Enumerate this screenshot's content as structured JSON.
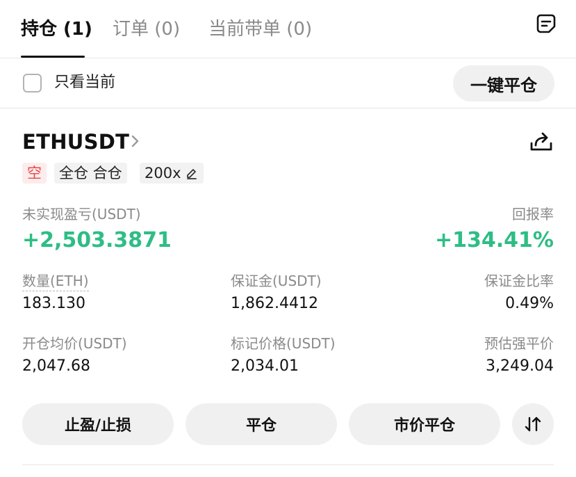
{
  "tabs": [
    {
      "label": "持仓 (1)"
    },
    {
      "label": "订单 (0)"
    },
    {
      "label": "当前带单 (0)"
    }
  ],
  "filter": {
    "only_current_label": "只看当前",
    "close_all_label": "一键平仓"
  },
  "position": {
    "symbol": "ETHUSDT",
    "tags": {
      "side": "空",
      "margin_mode": "全仓 合仓",
      "leverage": "200x"
    },
    "unrealized_pnl_label": "未实现盈亏(USDT)",
    "unrealized_pnl_value": "+2,503.3871",
    "roe_label": "回报率",
    "roe_value": "+134.41%",
    "quantity_label": "数量(ETH)",
    "quantity_value": "183.130",
    "margin_label": "保证金(USDT)",
    "margin_value": "1,862.4412",
    "margin_ratio_label": "保证金比率",
    "margin_ratio_value": "0.49%",
    "entry_price_label": "开仓均价(USDT)",
    "entry_price_value": "2,047.68",
    "mark_price_label": "标记价格(USDT)",
    "mark_price_value": "2,034.01",
    "liq_price_label": "预估强平价",
    "liq_price_value": "3,249.04"
  },
  "actions": {
    "tpsl_label": "止盈/止损",
    "close_label": "平仓",
    "market_close_label": "市价平仓"
  },
  "icons": {
    "orders": "document-list-icon",
    "chevron": "chevron-right-icon",
    "share": "share-icon",
    "edit": "pencil-icon",
    "reverse": "swap-vertical-icon"
  },
  "colors": {
    "profit": "#2ebd85",
    "short": "#e5484d"
  }
}
